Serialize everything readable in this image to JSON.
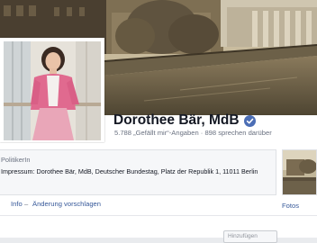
{
  "page": {
    "name": "Dorothee Bär, MdB",
    "verified_icon": "verified-badge-icon",
    "accent": "#4c6eb5"
  },
  "stats": {
    "text": "5.788 „Gefällt mir“-Angaben · 898 sprechen darüber"
  },
  "about": {
    "category": "PolitikerIn",
    "impressum": "Impressum: Dorothee Bär, MdB, Deutscher Bundestag, Platz der Republik 1, 11011 Berlin"
  },
  "tabs": {
    "info": "Info",
    "separator": "–",
    "suggest": "Änderung vorschlagen",
    "photos": "Fotos"
  },
  "bottom_button": {
    "label": "Hinzufügen"
  }
}
